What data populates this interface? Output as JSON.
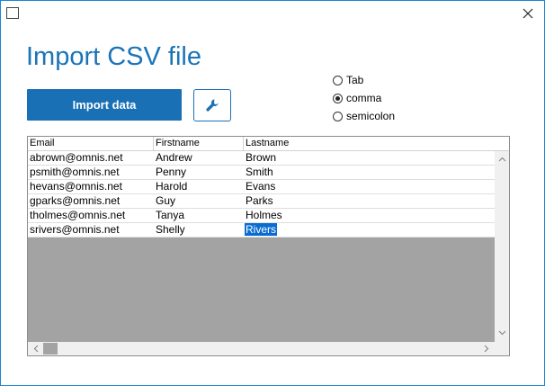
{
  "window": {
    "close_glyph": "✕"
  },
  "page": {
    "title": "Import CSV file"
  },
  "toolbar": {
    "import_label": "Import data",
    "tool_icon": "wrench-icon"
  },
  "delimiter": {
    "options": [
      {
        "label": "Tab",
        "checked": false
      },
      {
        "label": "comma",
        "checked": true
      },
      {
        "label": "semicolon",
        "checked": false
      }
    ]
  },
  "table": {
    "columns": [
      "Email",
      "Firstname",
      "Lastname"
    ],
    "rows": [
      [
        "abrown@omnis.net",
        "Andrew",
        "Brown"
      ],
      [
        "psmith@omnis.net",
        "Penny",
        "Smith"
      ],
      [
        "hevans@omnis.net",
        "Harold",
        "Evans"
      ],
      [
        "gparks@omnis.net",
        "Guy",
        "Parks"
      ],
      [
        "tholmes@omnis.net",
        "Tanya",
        "Holmes"
      ],
      [
        "srivers@omnis.net",
        "Shelly",
        "Rivers"
      ]
    ],
    "selected_cell": {
      "row": 5,
      "col": 2
    }
  },
  "colors": {
    "accent": "#1a70b5",
    "title": "#1a74b8",
    "selection": "#0a6cd1",
    "empty_area": "#a3a3a3"
  }
}
